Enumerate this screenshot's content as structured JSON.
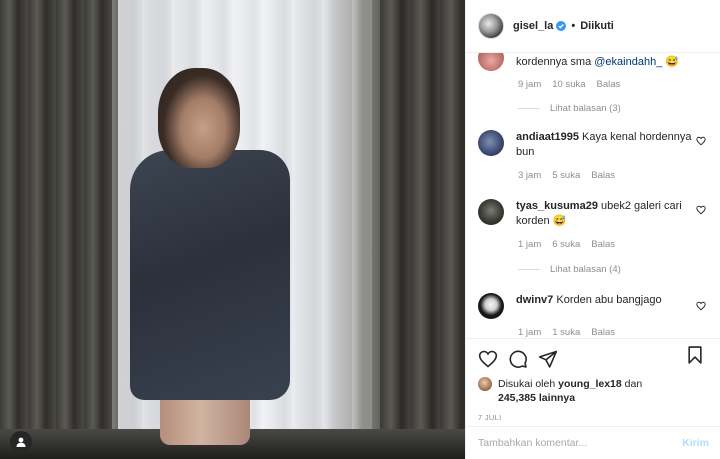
{
  "header": {
    "username": "gisel_la",
    "separator": "•",
    "follow_label": "Diikuti"
  },
  "comments": {
    "partial": {
      "text": "kordennya sma ",
      "mention": "@ekaindahh_",
      "emoji": "😅",
      "time": "9 jam",
      "likes": "10 suka",
      "reply": "Balas",
      "view_replies": "Lihat balasan (3)"
    },
    "items": [
      {
        "username": "andiaat1995",
        "text": "Kaya kenal hordennya bun",
        "time": "3 jam",
        "likes": "5 suka",
        "reply": "Balas"
      },
      {
        "username": "tyas_kusuma29",
        "text": "ubek2 galeri cari korden 😅",
        "time": "1 jam",
        "likes": "6 suka",
        "reply": "Balas",
        "view_replies": "Lihat balasan (4)"
      },
      {
        "username": "dwinv7",
        "text": "Korden abu bangjago",
        "time": "1 jam",
        "likes": "1 suka",
        "reply": "Balas"
      }
    ]
  },
  "likes": {
    "prefix": "Disukai oleh",
    "user": "young_lex18",
    "conj": "dan",
    "count": "245,385",
    "suffix": "lainnya"
  },
  "date": "7 JULI",
  "composer": {
    "placeholder": "Tambahkan komentar...",
    "post_label": "Kirim"
  },
  "colors": {
    "verified": "#3897f0",
    "mention": "#00376b",
    "muted": "#8e8e8e",
    "post_disabled": "#b2dffc"
  }
}
